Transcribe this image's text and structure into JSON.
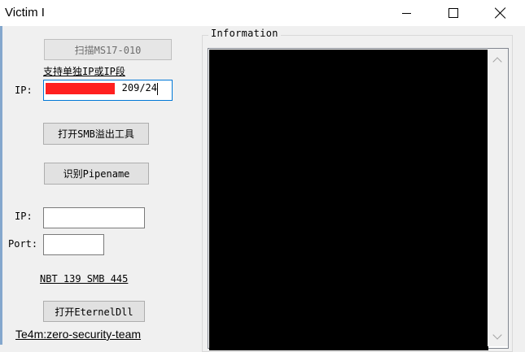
{
  "window": {
    "title": "Victim I",
    "controls": [
      "minimize",
      "maximize",
      "close"
    ]
  },
  "buttons": {
    "scan": "扫描MS17-010",
    "open_smb": "打开SMB溢出工具",
    "identify_pipename": "识别Pipename",
    "open_eternal_dll": "打开EternelDll"
  },
  "labels": {
    "support_hint": "支持单独IP或IP段",
    "ip_1": "IP:",
    "ip_2": "IP:",
    "port": "Port:",
    "ports_hint": "NBT 139 SMB 445",
    "team_link": "Te4m:zero-security-team"
  },
  "inputs": {
    "scan_ip_value": "209/24",
    "target_ip_value": "",
    "target_port_value": ""
  },
  "info_group": {
    "title": "Information",
    "content": ""
  },
  "colors": {
    "redaction": "#ff2020",
    "console_bg": "#000000",
    "focus_border": "#0078d7"
  }
}
